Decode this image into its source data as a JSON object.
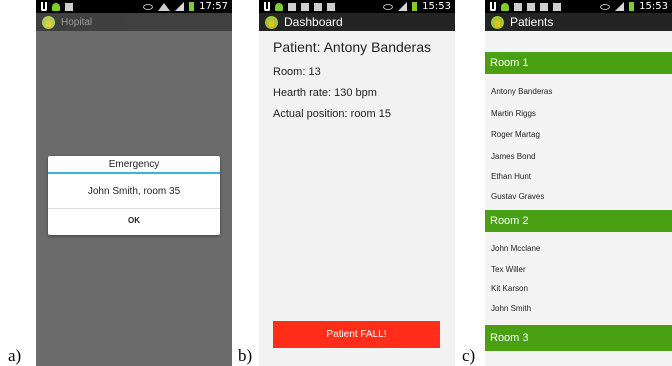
{
  "captions": {
    "a": "a)",
    "b": "b)",
    "c": "c)"
  },
  "colors": {
    "green_header": "#49a013",
    "fall_button": "#ff2d19",
    "dialog_accent": "#33b5e5",
    "app_bar": "#242424"
  },
  "panel_a": {
    "status_time": "17:57",
    "app_title": "Hopital",
    "dialog": {
      "title": "Emergency",
      "message": "John Smith, room 35",
      "ok_label": "OK"
    }
  },
  "panel_b": {
    "status_time": "15:53",
    "app_title": "Dashboard",
    "patient_title": "Patient: Antony Banderas",
    "room": "Room: 13",
    "heart_rate": "Hearth rate: 130 bpm",
    "position": "Actual position: room 15",
    "fall_button": "Patient FALL!"
  },
  "panel_c": {
    "status_time": "15:53",
    "app_title": "Patients",
    "rooms": [
      {
        "name": "Room 1",
        "patients": [
          "Antony Banderas",
          "Martin Riggs",
          "Roger Martag",
          "James Bond",
          "Ethan Hunt",
          "Gustav Graves"
        ]
      },
      {
        "name": "Room 2",
        "patients": [
          "John Mcclane",
          "Tex Willer",
          "Kit Karson",
          "John Smith"
        ]
      },
      {
        "name": "Room 3",
        "patients": []
      }
    ]
  }
}
